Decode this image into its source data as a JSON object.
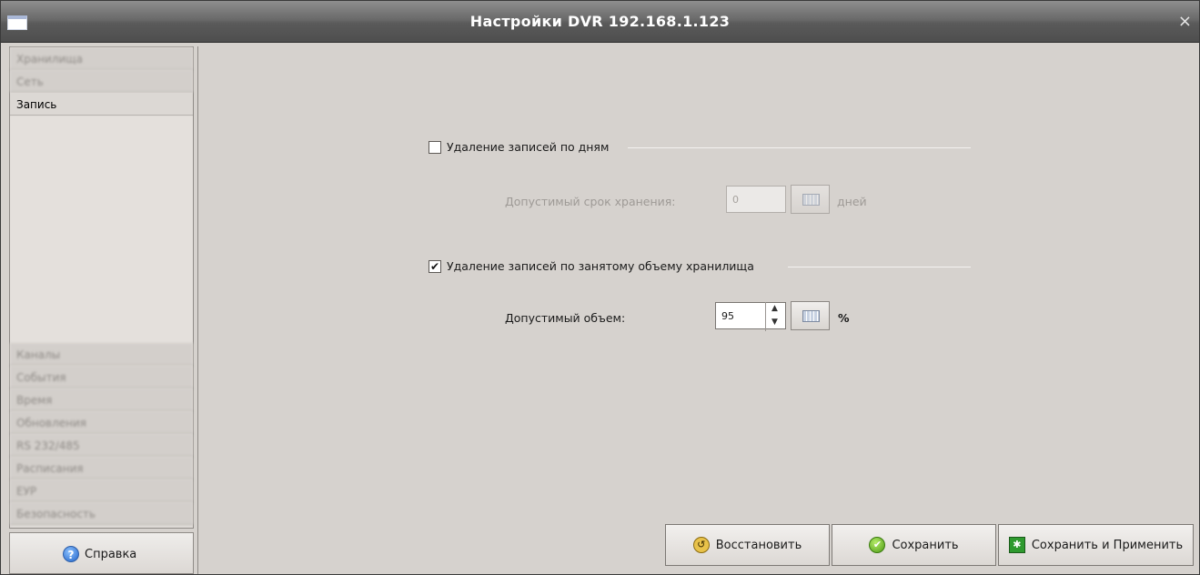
{
  "window": {
    "title": "Настройки DVR 192.168.1.123",
    "close_glyph": "×"
  },
  "sidebar": {
    "items": [
      {
        "label": "Хранилища"
      },
      {
        "label": "Сеть"
      },
      {
        "label": "Запись",
        "active": true
      },
      {
        "label": "Каналы"
      },
      {
        "label": "События"
      },
      {
        "label": "Время"
      },
      {
        "label": "Обновления"
      },
      {
        "label": "RS 232/485"
      },
      {
        "label": "Расписания"
      },
      {
        "label": "ЕУР"
      },
      {
        "label": "Безопасность"
      }
    ],
    "help_label": "Справка"
  },
  "settings": {
    "by_days": {
      "label": "Удаление записей по дням",
      "checked": false,
      "field_label": "Допустимый срок хранения:",
      "value": "0",
      "unit": "дней"
    },
    "by_volume": {
      "label": "Удаление записей по занятому объему хранилища",
      "checked": true,
      "check_glyph": "✔",
      "field_label": "Допустимый объем:",
      "value": "95",
      "unit": "%"
    }
  },
  "actions": {
    "restore_label": "Восстановить",
    "save_label": "Сохранить",
    "save_apply_label": "Сохранить и Применить"
  },
  "icons": {
    "help": "?",
    "restore": "↺",
    "save": "✔",
    "apply": "✱",
    "spin_up": "▲",
    "spin_down": "▼"
  }
}
